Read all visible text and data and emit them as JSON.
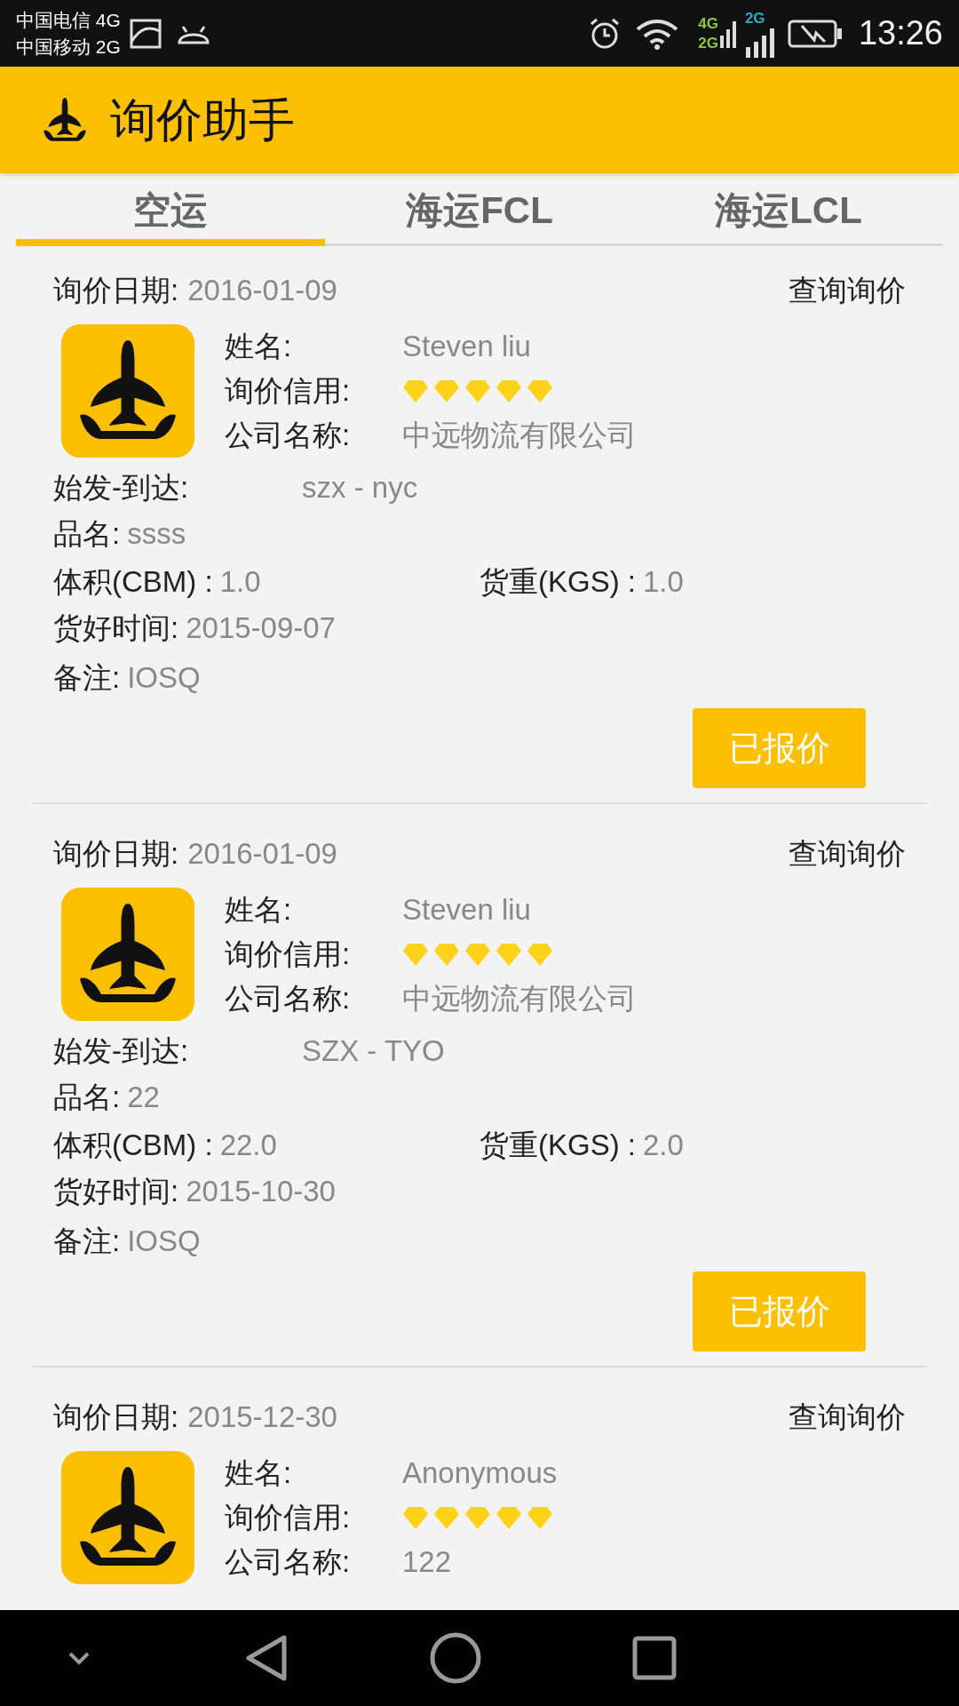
{
  "status_bar": {
    "carriers": [
      "中国电信 4G",
      "中国移动 2G"
    ],
    "network_labels": [
      "4G",
      "2G",
      "2G"
    ],
    "time": "13:26"
  },
  "app_bar": {
    "title": "询价助手"
  },
  "tabs": [
    {
      "label": "空运",
      "selected": true
    },
    {
      "label": "海运FCL",
      "selected": false
    },
    {
      "label": "海运LCL",
      "selected": false
    }
  ],
  "inquiries": [
    {
      "date_label": "询价日期:",
      "date": "2016-01-09",
      "action": "查询询价",
      "name_label": "姓名:",
      "name": "Steven liu",
      "credit_label": "询价信用:",
      "stars": 5,
      "company_label": "公司名称:",
      "company": "中远物流有限公司",
      "route_label": "始发-到达:",
      "route": "szx - nyc",
      "product_label": "品名:",
      "product": "ssss",
      "volume_label": "体积(CBM) :",
      "volume": "1.0",
      "weight_label": "货重(KGS) :",
      "weight": "1.0",
      "ready_label": "货好时间:",
      "ready": "2015-09-07",
      "remark_label": "备注:",
      "remark": "IOSQ",
      "button": "已报价"
    },
    {
      "date_label": "询价日期:",
      "date": "2016-01-09",
      "action": "查询询价",
      "name_label": "姓名:",
      "name": "Steven liu",
      "credit_label": "询价信用:",
      "stars": 5,
      "company_label": "公司名称:",
      "company": "中远物流有限公司",
      "route_label": "始发-到达:",
      "route": "SZX - TYO",
      "product_label": "品名:",
      "product": "22",
      "volume_label": "体积(CBM) :",
      "volume": "22.0",
      "weight_label": "货重(KGS) :",
      "weight": "2.0",
      "ready_label": "货好时间:",
      "ready": "2015-10-30",
      "remark_label": "备注:",
      "remark": "IOSQ",
      "button": "已报价"
    },
    {
      "date_label": "询价日期:",
      "date": "2015-12-30",
      "action": "查询询价",
      "name_label": "姓名:",
      "name": "Anonymous",
      "credit_label": "询价信用:",
      "stars": 5,
      "company_label": "公司名称:",
      "company": "122"
    }
  ]
}
